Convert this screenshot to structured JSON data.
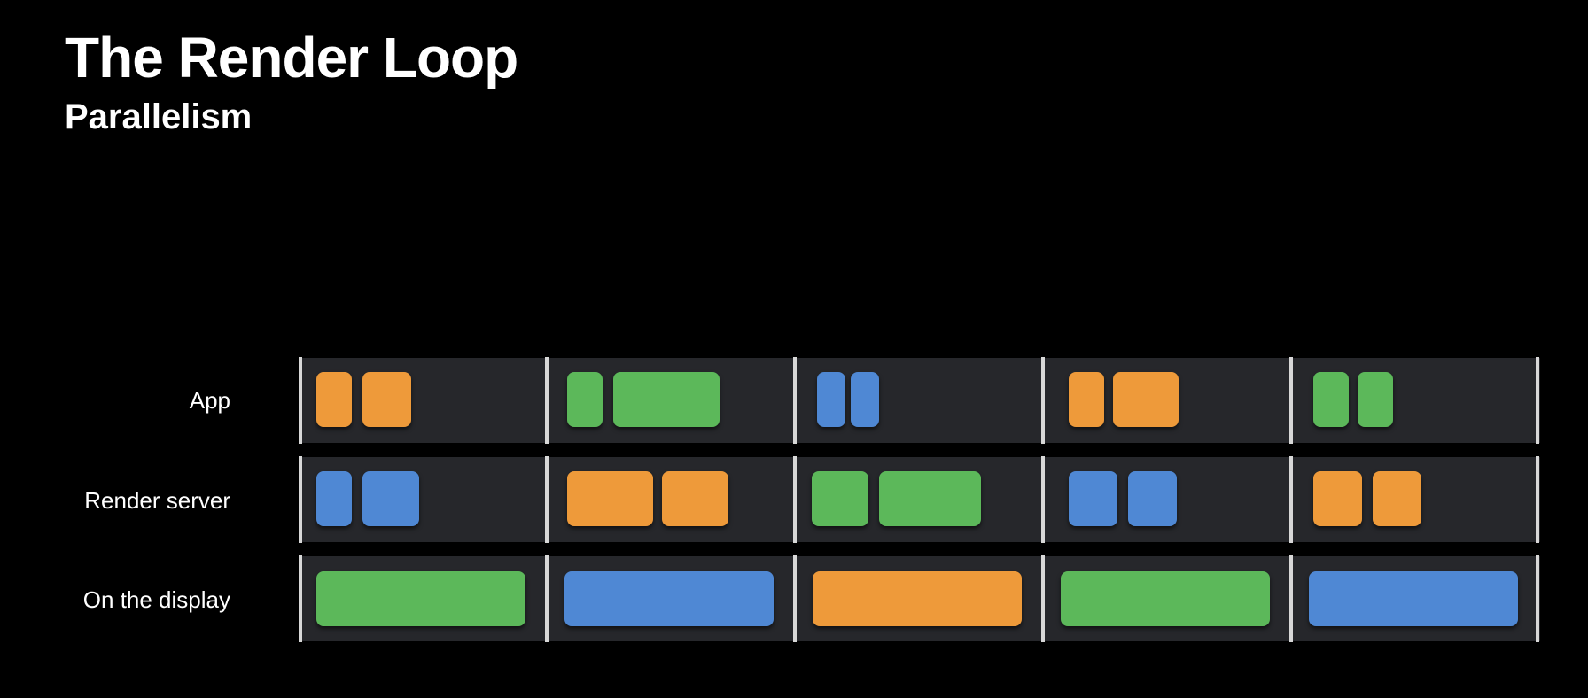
{
  "slide": {
    "title": "The Render Loop",
    "subtitle": "Parallelism"
  },
  "colors": {
    "orange": "#ee9a3a",
    "green": "#5cb85a",
    "blue": "#4f88d4",
    "track": "#26272b",
    "divider": "#d8d8d8",
    "background": "#000000"
  },
  "rows": [
    {
      "label": "App",
      "frames": [
        {
          "color": "orange",
          "blocks": 2
        },
        {
          "color": "green",
          "blocks": 2
        },
        {
          "color": "blue",
          "blocks": 2
        },
        {
          "color": "orange",
          "blocks": 2
        },
        {
          "color": "green",
          "blocks": 2
        }
      ]
    },
    {
      "label": "Render server",
      "frames": [
        {
          "color": "blue",
          "blocks": 2
        },
        {
          "color": "orange",
          "blocks": 2
        },
        {
          "color": "green",
          "blocks": 2
        },
        {
          "color": "blue",
          "blocks": 2
        },
        {
          "color": "orange",
          "blocks": 2
        }
      ]
    },
    {
      "label": "On the display",
      "frames": [
        {
          "color": "green",
          "blocks": 1
        },
        {
          "color": "blue",
          "blocks": 1
        },
        {
          "color": "orange",
          "blocks": 1
        },
        {
          "color": "green",
          "blocks": 1
        },
        {
          "color": "blue",
          "blocks": 1
        }
      ]
    }
  ]
}
